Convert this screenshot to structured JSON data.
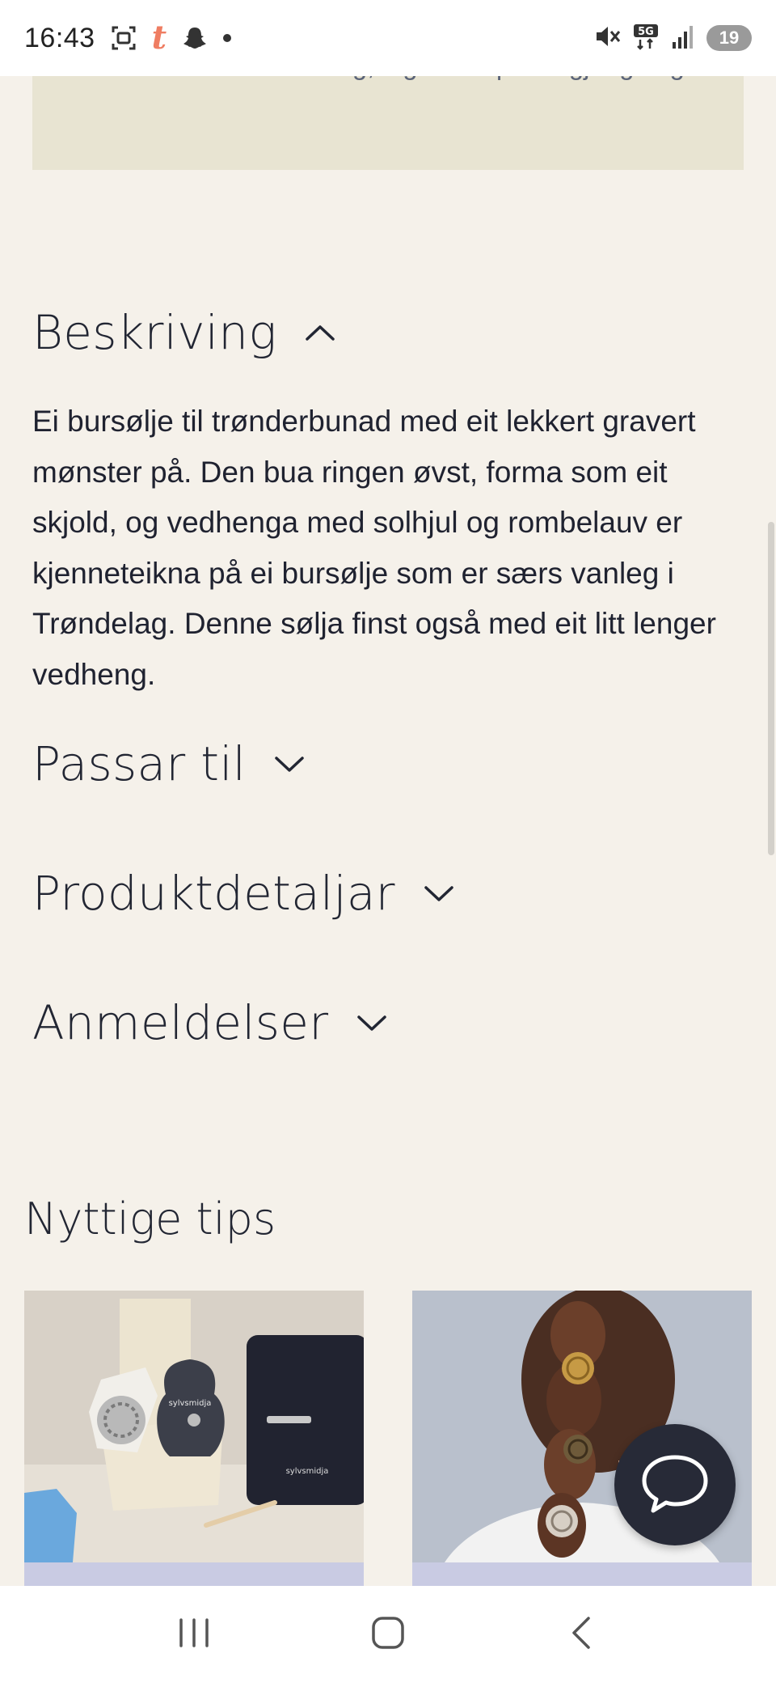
{
  "status_bar": {
    "time": "16:43",
    "battery": "19",
    "icons": [
      "screenshot-icon",
      "t-app-icon",
      "snapchat-icon",
      "notification-dot-icon",
      "mute-icon",
      "5g-icon",
      "signal-icon",
      "battery-icon"
    ]
  },
  "notice": {
    "text": "Sender kun innad i Noreg, ingen eksport tilgjengeleg"
  },
  "accordion": {
    "beskriving": {
      "title": "Beskriving",
      "expanded": true,
      "body": "Ei bursølje til trønderbunad med eit lekkert gravert mønster på. Den bua ringen øvst, forma som eit skjold, og vedhenga med solhjul og rombelauv er kjenneteikna på ei bursølje som er særs vanleg i Trøndelag. Denne sølja finst også med eit litt lenger vedheng."
    },
    "passar": {
      "title": "Passar til",
      "expanded": false
    },
    "produkt": {
      "title": "Produktdetaljar",
      "expanded": false
    },
    "anmeld": {
      "title": "Anmeldelser",
      "expanded": false
    }
  },
  "tips": {
    "heading": "Nyttige tips",
    "cards": [
      {
        "image": "sylvsmidja-cleaning-kit-photo",
        "brand_text": "sylvsmidja"
      },
      {
        "image": "hair-brooch-photo"
      }
    ]
  },
  "colors": {
    "background": "#f5f1ea",
    "notice_bg": "#e8e4d2",
    "chat_fab": "#272a37",
    "card_strip": "#c9cbe3"
  },
  "nav": {
    "icons": [
      "recents-icon",
      "home-icon",
      "back-icon"
    ]
  }
}
